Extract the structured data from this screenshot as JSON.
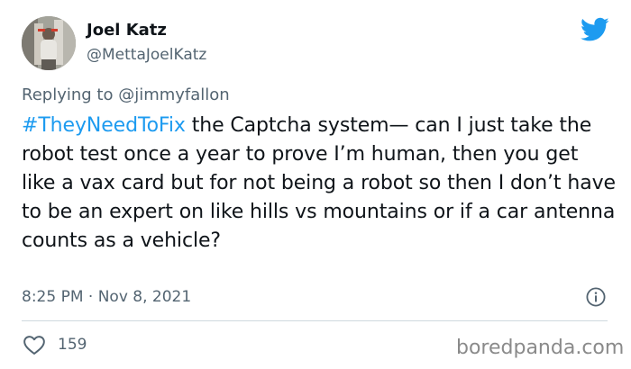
{
  "author": {
    "display_name": "Joel Katz",
    "handle": "@MettaJoelKatz"
  },
  "reply": {
    "prefix": "Replying to ",
    "user": "@jimmyfallon"
  },
  "tweet": {
    "hashtag": "#TheyNeedToFix",
    "text": " the Captcha system— can I just take the robot test once a year to prove I’m human, then you get like a vax card but for not being a robot so then I don’t have to be an expert on like hills vs mountains or if a car antenna counts as a vehicle?"
  },
  "meta": {
    "timestamp": "8:25 PM · Nov 8, 2021"
  },
  "stats": {
    "likes": "159"
  },
  "watermark": "boredpanda.com",
  "icons": {
    "logo": "twitter-bird-icon",
    "info": "info-icon",
    "like": "heart-icon"
  },
  "colors": {
    "accent": "#1d9bf0",
    "text": "#0f1419",
    "secondary": "#536471",
    "divider": "#cfd9de",
    "watermark": "#8a8a8a"
  }
}
